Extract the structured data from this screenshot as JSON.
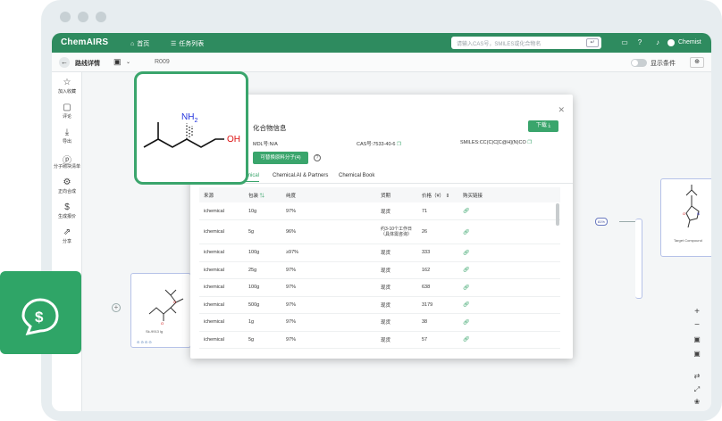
{
  "app": {
    "logo": "ChemAIRS",
    "nav": [
      {
        "icon": "home-icon",
        "label": "首页"
      },
      {
        "icon": "list-icon",
        "label": "任务列表"
      }
    ],
    "search_placeholder": "请输入CAS号，SMILES或化合物名",
    "user": "Chemist"
  },
  "subbar": {
    "title": "路线详情",
    "id": "R009",
    "toggle_label": "显示条件"
  },
  "sidebar": [
    {
      "icon": "star-icon",
      "label": "加入收藏"
    },
    {
      "icon": "comment-icon",
      "label": "评论"
    },
    {
      "icon": "download-icon",
      "label": "导出"
    },
    {
      "icon": "molecule-list-icon",
      "label": "分子砌块清单"
    },
    {
      "icon": "forward-synthesis-icon",
      "label": "正向合成"
    },
    {
      "icon": "dollar-icon",
      "label": "生成报价"
    },
    {
      "icon": "share-icon",
      "label": "分享"
    }
  ],
  "structure_card": {
    "nh2": "NH",
    "sub": "2",
    "oh": "OH"
  },
  "left_node": {
    "label": "Sk-9913 lg"
  },
  "target_node": {
    "label": "Target Compound"
  },
  "modal": {
    "title": "化合物信息",
    "download": "下载",
    "mdl": "MDL号:N/A",
    "cas": "CAS号:7533-40-6",
    "smiles": "SMILES:CC(C)C[C@H](N)CO",
    "replace_btn": "可替换原料分子(4)",
    "tabs": [
      "ichemical",
      "Chemical.AI & Partners",
      "Chemical Book"
    ],
    "columns": [
      "来源",
      "包装",
      "纯度",
      "货期",
      "价格（¥）",
      "购买链接"
    ],
    "rows": [
      {
        "source": "ichemical",
        "pack": "10g",
        "purity": "97%",
        "lead": "现货",
        "price": "71"
      },
      {
        "source": "ichemical",
        "pack": "5g",
        "purity": "96%",
        "lead": "约3-10个工作日（具体需咨询）",
        "price": "26"
      },
      {
        "source": "ichemical",
        "pack": "100g",
        "purity": "≥97%",
        "lead": "现货",
        "price": "333"
      },
      {
        "source": "ichemical",
        "pack": "25g",
        "purity": "97%",
        "lead": "现货",
        "price": "162"
      },
      {
        "source": "ichemical",
        "pack": "100g",
        "purity": "97%",
        "lead": "现货",
        "price": "638"
      },
      {
        "source": "ichemical",
        "pack": "500g",
        "purity": "97%",
        "lead": "现货",
        "price": "3179"
      },
      {
        "source": "ichemical",
        "pack": "1g",
        "purity": "97%",
        "lead": "现货",
        "price": "38"
      },
      {
        "source": "ichemical",
        "pack": "5g",
        "purity": "97%",
        "lead": "现货",
        "price": "57"
      }
    ]
  },
  "colors": {
    "brand": "#2e8b5f",
    "accent": "#3aa56c",
    "node_border": "#b6c2e8"
  }
}
